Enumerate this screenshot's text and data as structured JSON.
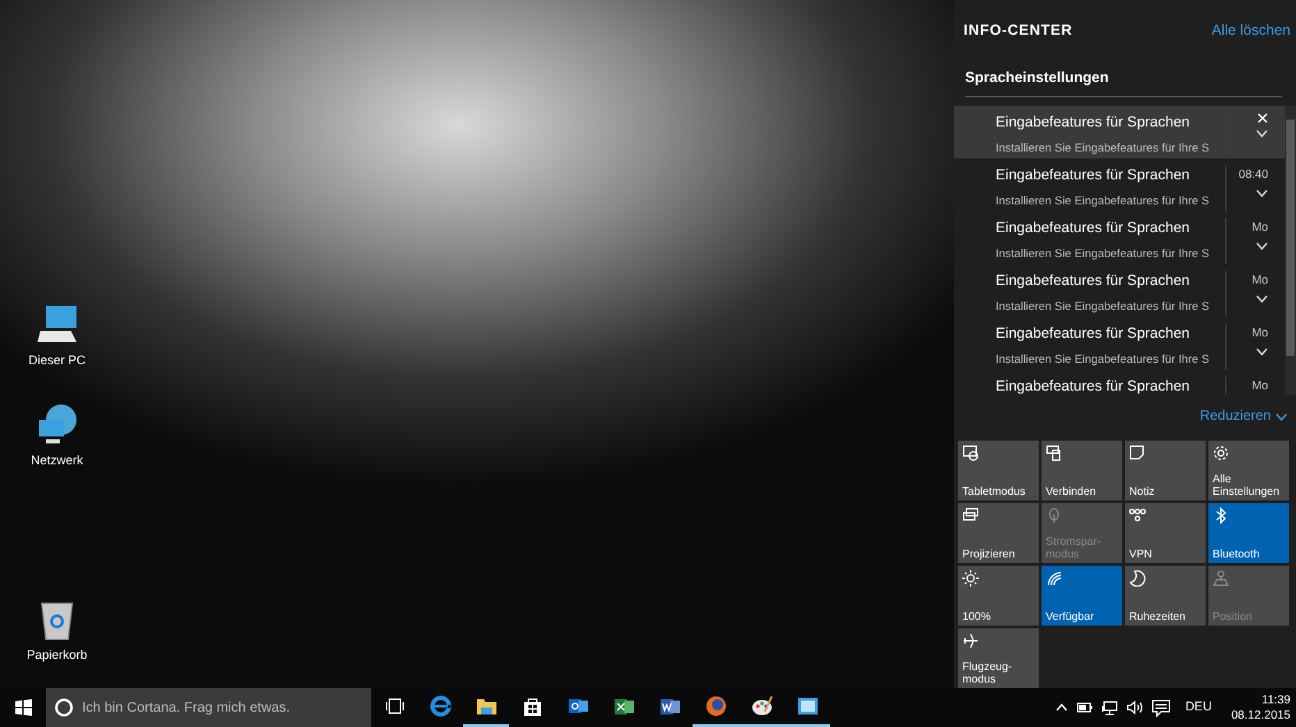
{
  "desktop": {
    "icons": [
      {
        "label": "Dieser PC"
      },
      {
        "label": "Netzwerk"
      },
      {
        "label": "Papierkorb"
      }
    ]
  },
  "action_center": {
    "title": "INFO-CENTER",
    "clear_all": "Alle löschen",
    "group": "Spracheinstellungen",
    "notifications": [
      {
        "title": "Eingabefeatures für Sprachen",
        "body": "Installieren Sie Eingabefeatures für Ihre S",
        "hovered": true
      },
      {
        "title": "Eingabefeatures für Sprachen",
        "body": "Installieren Sie Eingabefeatures für Ihre S",
        "time": "08:40",
        "hovered": false
      },
      {
        "title": "Eingabefeatures für Sprachen",
        "body": "Installieren Sie Eingabefeatures für Ihre S",
        "time": "Mo",
        "hovered": false
      },
      {
        "title": "Eingabefeatures für Sprachen",
        "body": "Installieren Sie Eingabefeatures für Ihre S",
        "time": "Mo",
        "hovered": false
      },
      {
        "title": "Eingabefeatures für Sprachen",
        "body": "Installieren Sie Eingabefeatures für Ihre S",
        "time": "Mo",
        "hovered": false
      },
      {
        "title": "Eingabefeatures für Sprachen",
        "time": "Mo",
        "hovered": false
      }
    ],
    "collapse": "Reduzieren",
    "quick_actions": [
      {
        "label": "Tabletmodus",
        "on": false,
        "disabled": false
      },
      {
        "label": "Verbinden",
        "on": false,
        "disabled": false
      },
      {
        "label": "Notiz",
        "on": false,
        "disabled": false
      },
      {
        "label": "Alle\nEinstellungen",
        "on": false,
        "disabled": false
      },
      {
        "label": "Projizieren",
        "on": false,
        "disabled": false
      },
      {
        "label": "Stromspar-\nmodus",
        "on": false,
        "disabled": true
      },
      {
        "label": "VPN",
        "on": false,
        "disabled": false
      },
      {
        "label": "Bluetooth",
        "on": true,
        "disabled": false
      },
      {
        "label": "100%",
        "on": false,
        "disabled": false
      },
      {
        "label": "Verfügbar",
        "on": true,
        "disabled": false
      },
      {
        "label": "Ruhezeiten",
        "on": false,
        "disabled": false
      },
      {
        "label": "Position",
        "on": false,
        "disabled": true
      },
      {
        "label": "Flugzeug-\nmodus",
        "on": false,
        "disabled": false
      }
    ]
  },
  "taskbar": {
    "search": {
      "placeholder": "Ich bin Cortana. Frag mich etwas."
    },
    "apps": [
      {
        "running": false
      },
      {
        "running": true
      },
      {
        "running": false
      },
      {
        "running": false
      },
      {
        "running": false
      },
      {
        "running": false
      },
      {
        "running": true
      },
      {
        "running": true
      },
      {
        "running": true
      }
    ],
    "language": "DEU",
    "time": "11:39",
    "date": "08.12.2015"
  }
}
